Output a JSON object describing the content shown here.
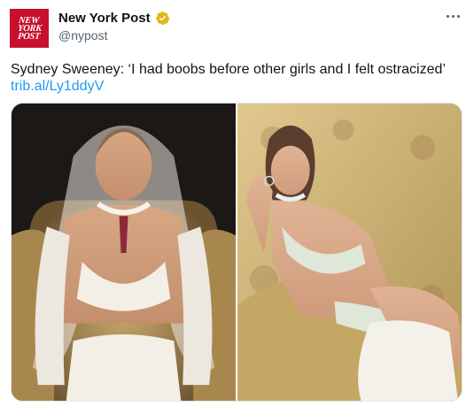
{
  "account": {
    "display_name": "New York Post",
    "handle": "@nypost",
    "logo_text": [
      "NEW",
      "YORK",
      "POST"
    ],
    "verified": true
  },
  "tweet": {
    "text": "Sydney Sweeney: ‘I had boobs before other girls and I felt ostracized’",
    "link": "trib.al/Ly1ddyV"
  },
  "icons": {
    "more": "more-horizontal-icon",
    "verified": "verified-badge-icon"
  },
  "colors": {
    "brand_red": "#c8102e",
    "link_blue": "#1d9bf0",
    "verified_gold": "#e2b719"
  }
}
